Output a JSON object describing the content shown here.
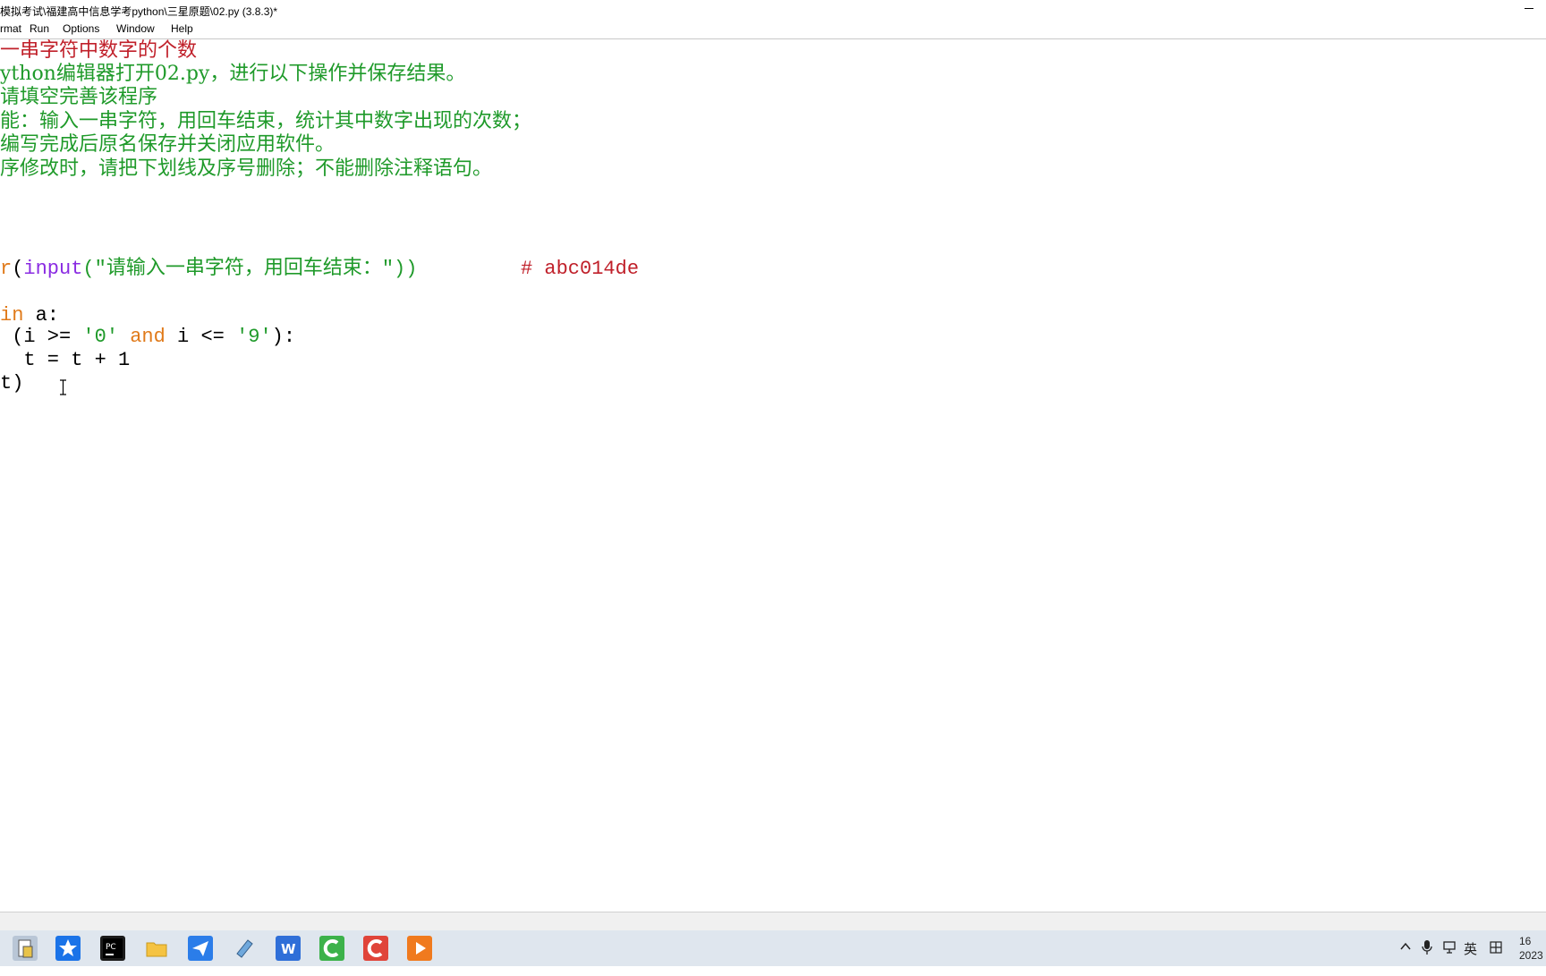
{
  "window": {
    "title": "模拟考试\\福建高中信息学考python\\三星原题\\02.py (3.8.3)*"
  },
  "menu": [
    "rmat",
    "Run",
    "Options",
    "Window",
    "Help"
  ],
  "editor": {
    "comment_lines": [
      "一串字符中数字的个数",
      "ython编辑器打开02.py，进行以下操作并保存结果。",
      "请填空完善该程序",
      "能：输入一串字符，用回车结束，统计其中数字出现的次数；",
      "编写完成后原名保存并关闭应用软件。",
      "序修改时，请把下划线及序号删除；不能删除注释语句。"
    ],
    "code": {
      "line1_a": "r",
      "line1_b": "(",
      "line1_input": "input",
      "line1_str": "(\"请输入一串字符，用回车结束：\"))",
      "line1_comment": "# abc014de",
      "line2_in": "in",
      "line2_rest": " a:",
      "line3_a": " (i >= ",
      "line3_s1": "'0'",
      "line3_and": "and",
      "line3_b": " i <= ",
      "line3_s2": "'9'",
      "line3_c": "):",
      "line4": "  t = t + 1",
      "line5": "t)"
    }
  },
  "tray": {
    "ime": "英",
    "time": "16",
    "date": "2023"
  },
  "colors": {
    "comment_red": "#c0202a",
    "string_green": "#1f9a2a",
    "builtin_purple": "#8a2be2",
    "keyword_orange": "#e07a1a"
  }
}
